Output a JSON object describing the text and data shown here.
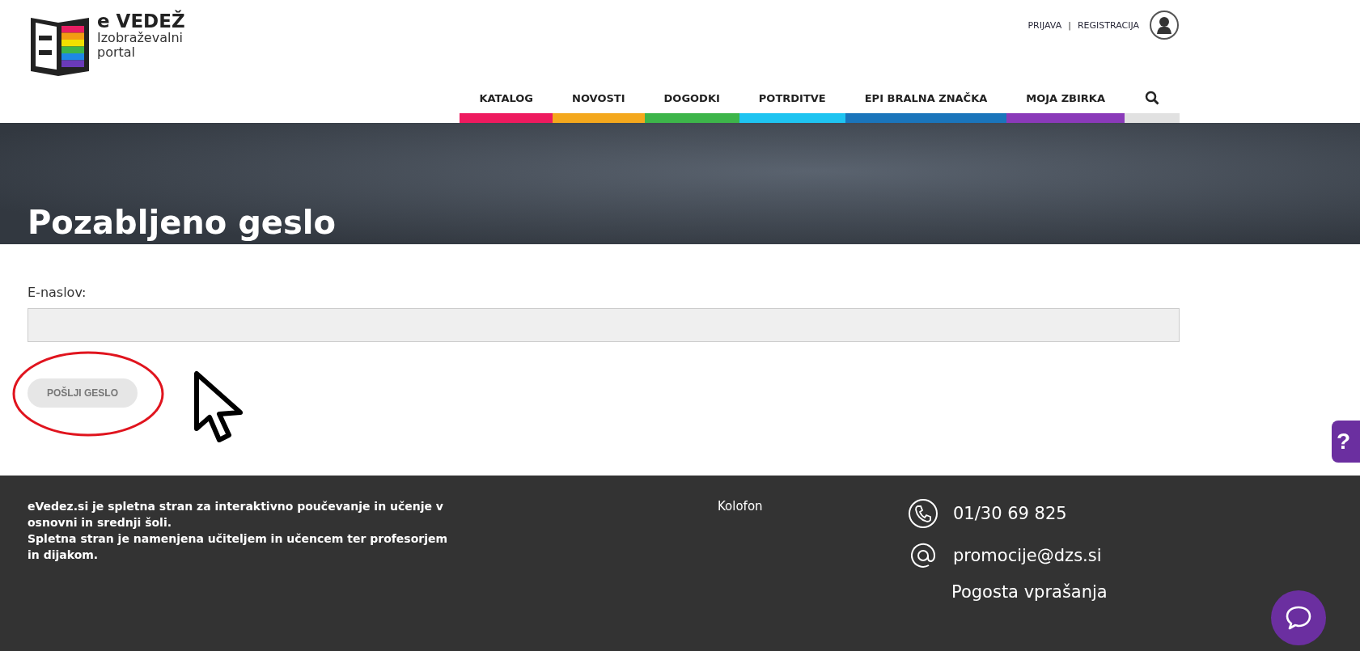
{
  "logo": {
    "name": "e VEDEŽ",
    "tagline_1": "Izobraževalni",
    "tagline_2": "portal"
  },
  "account": {
    "login": "PRIJAVA",
    "separator": "|",
    "register": "REGISTRACIJA"
  },
  "nav": [
    {
      "label": "KATALOG",
      "color": "#ee1a5f"
    },
    {
      "label": "NOVOSTI",
      "color": "#f4a81d"
    },
    {
      "label": "DOGODKI",
      "color": "#3db54a"
    },
    {
      "label": "POTRDITVE",
      "color": "#1ec4f1"
    },
    {
      "label": "EPI BRALNA ZNAČKA",
      "color": "#1a75bb"
    },
    {
      "label": "MOJA ZBIRKA",
      "color": "#8a3ab9"
    },
    {
      "kind": "search",
      "color": "#e1e1e1"
    }
  ],
  "banner": {
    "title": "Pozabljeno geslo"
  },
  "form": {
    "label": "E-naslov:",
    "submit": "POŠLJI GESLO"
  },
  "help_tab": {
    "label": "?"
  },
  "footer": {
    "about_1": "eVedez.si je spletna stran za interaktivno poučevanje in učenje v osnovni in srednji šoli.",
    "about_2": "Spletna stran je namenjena učiteljem in učencem ter profesorjem in dijakom.",
    "colophon": "Kolofon",
    "phone": "01/30 69 825",
    "email": "promocije@dzs.si",
    "faq": "Pogosta vprašanja"
  }
}
